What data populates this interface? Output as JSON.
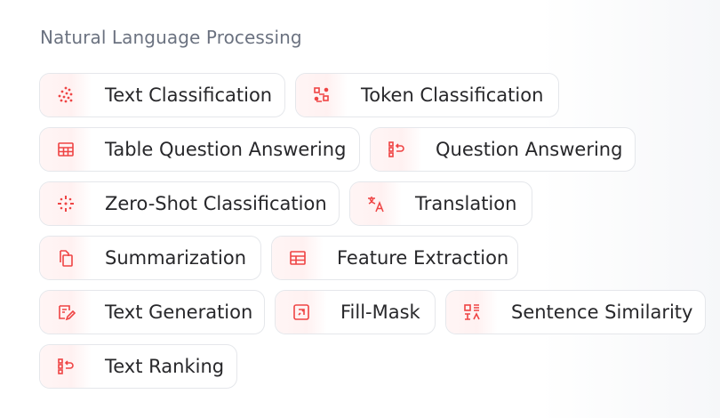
{
  "section": {
    "title": "Natural Language Processing"
  },
  "tasks": [
    {
      "label": "Text Classification",
      "icon": "dots-scatter-icon"
    },
    {
      "label": "Token Classification",
      "icon": "token-grid-icon"
    },
    {
      "label": "Table Question Answering",
      "icon": "table-icon"
    },
    {
      "label": "Question Answering",
      "icon": "list-return-icon"
    },
    {
      "label": "Zero-Shot Classification",
      "icon": "sparkle-dots-icon"
    },
    {
      "label": "Translation",
      "icon": "translate-icon"
    },
    {
      "label": "Summarization",
      "icon": "documents-icon"
    },
    {
      "label": "Feature Extraction",
      "icon": "table-grid-icon"
    },
    {
      "label": "Text Generation",
      "icon": "edit-doc-icon"
    },
    {
      "label": "Fill-Mask",
      "icon": "mask-frame-icon"
    },
    {
      "label": "Sentence Similarity",
      "icon": "similarity-icon"
    },
    {
      "label": "Text Ranking",
      "icon": "ranking-icon"
    }
  ],
  "colors": {
    "accent": "#ef4444",
    "text": "#27272a",
    "muted": "#6b7280",
    "border": "#e5e7eb"
  }
}
